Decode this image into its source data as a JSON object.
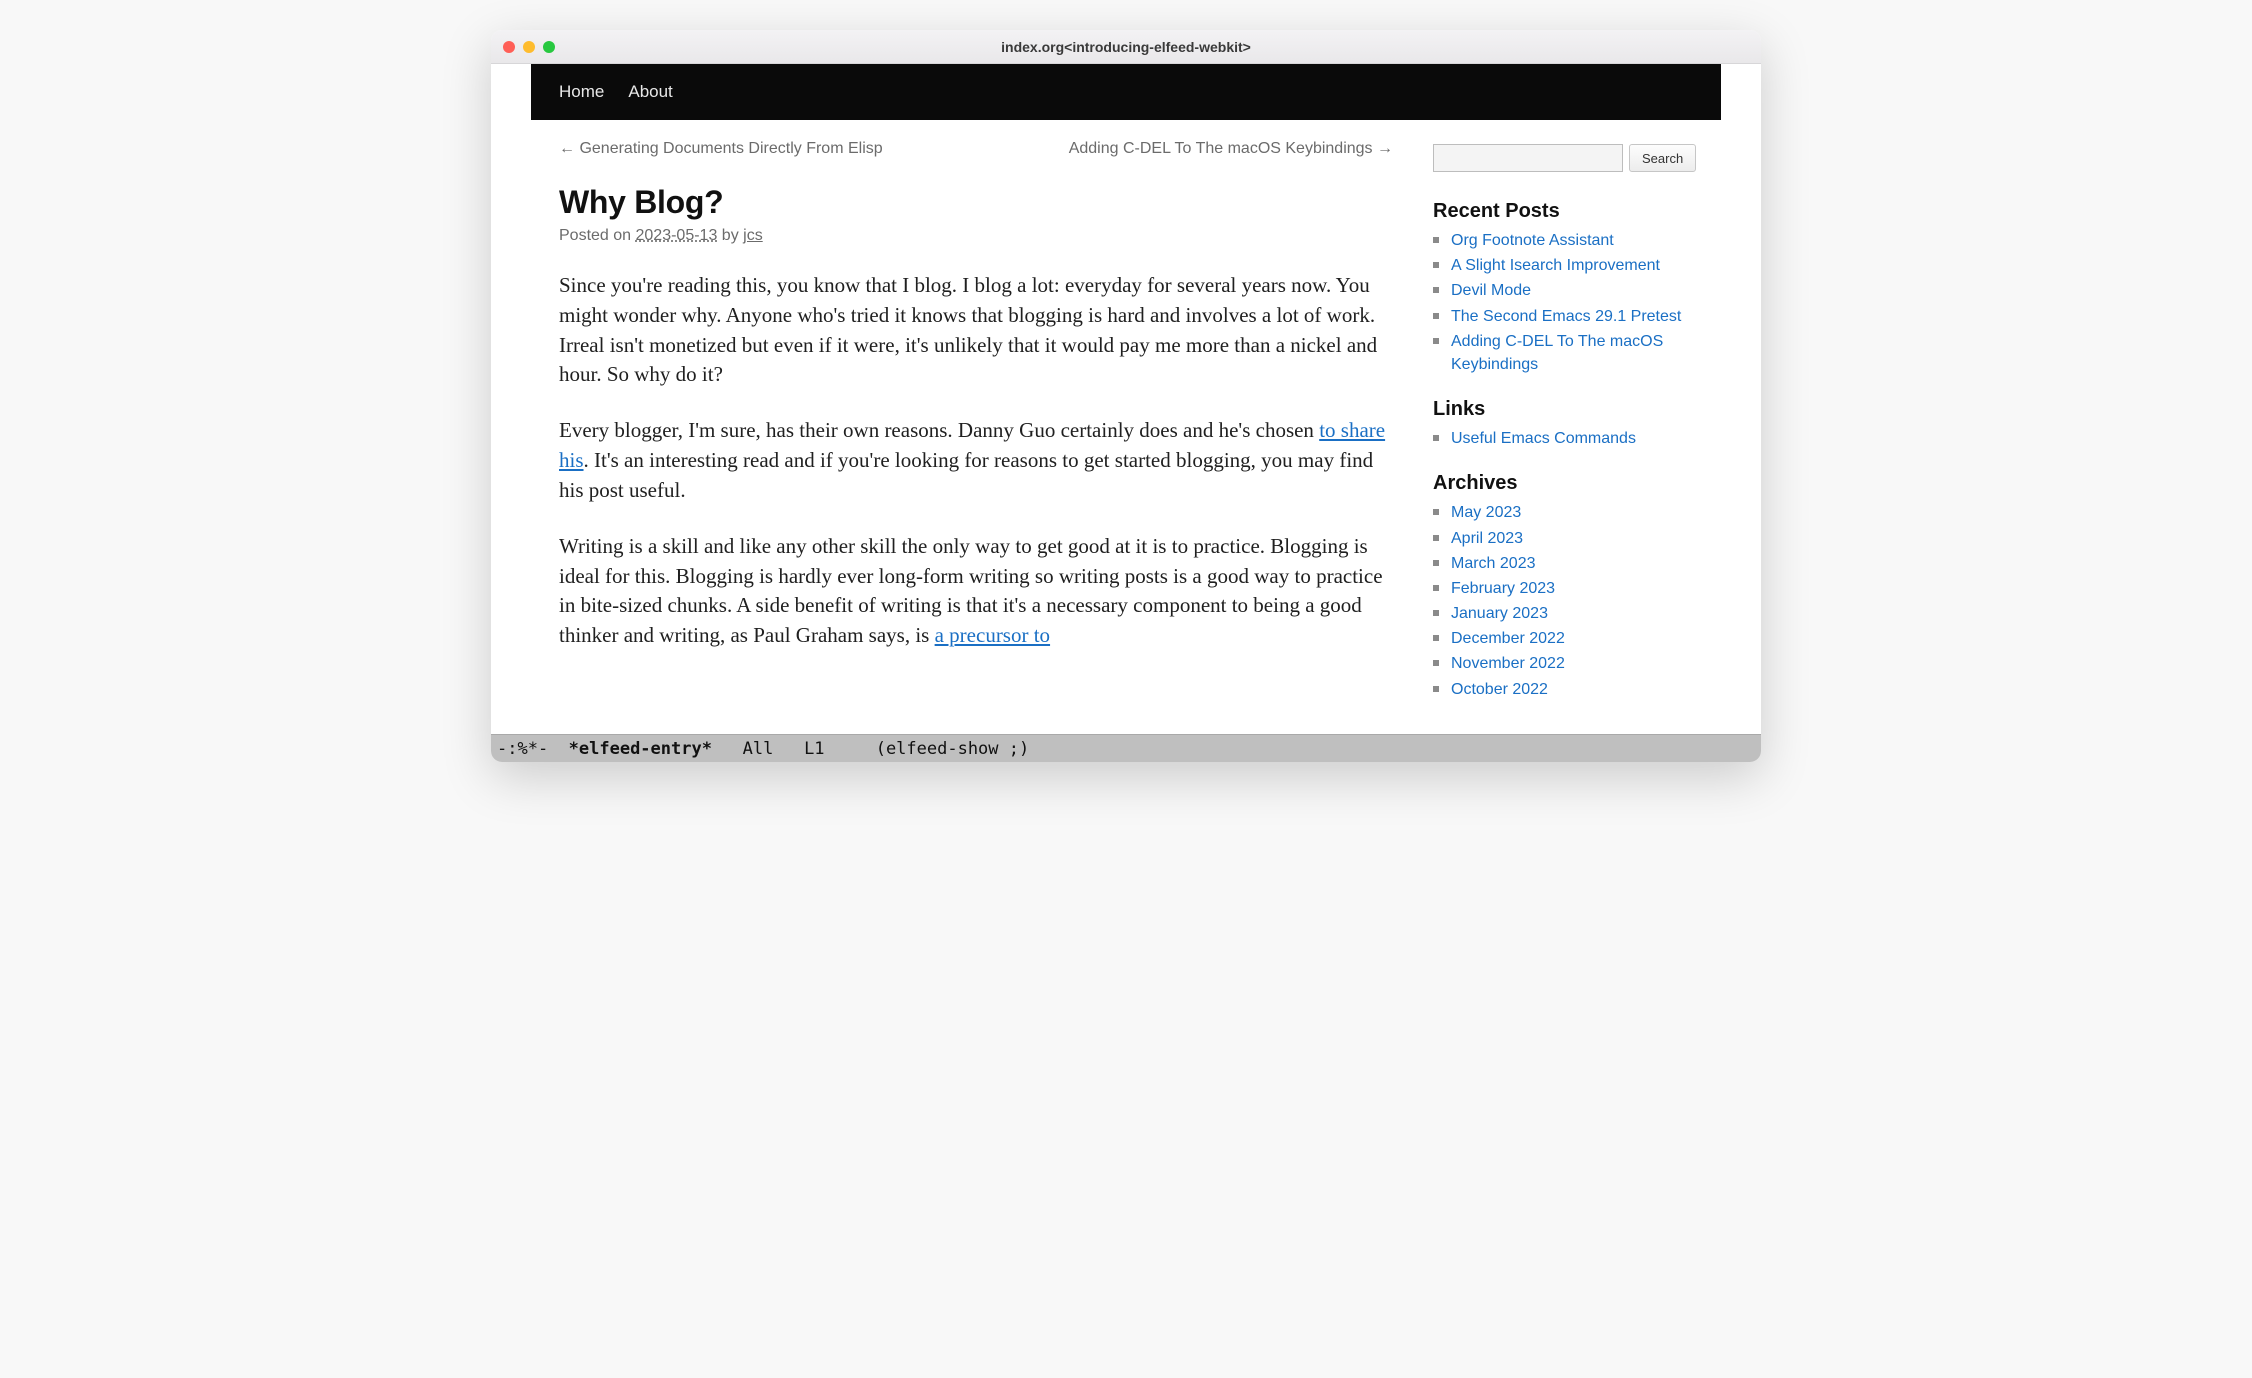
{
  "window": {
    "title": "index.org<introducing-elfeed-webkit>"
  },
  "nav": {
    "items": [
      "Home",
      "About"
    ]
  },
  "post_nav": {
    "prev": "← Generating Documents Directly From Elisp",
    "next": "Adding C-DEL To The macOS Keybindings →"
  },
  "post": {
    "title": "Why Blog?",
    "posted_on_label": "Posted on ",
    "date": "2023-05-13",
    "by_label": " by ",
    "author": "jcs",
    "p1": "Since you're reading this, you know that I blog. I blog a lot: everyday for several years now. You might wonder why. Anyone who's tried it knows that blogging is hard and involves a lot of work. Irreal isn't monetized but even if it were, it's unlikely that it would pay me more than a nickel and hour. So why do it?",
    "p2a": "Every blogger, I'm sure, has their own reasons. Danny Guo certainly does and he's chosen ",
    "p2_link": "to share his",
    "p2b": ". It's an interesting read and if you're looking for reasons to get started blogging, you may find his post useful.",
    "p3a": "Writing is a skill and like any other skill the only way to get good at it is to practice. Blogging is ideal for this. Blogging is hardly ever long-form writing so writing posts is a good way to practice in bite-sized chunks. A side benefit of writing is that it's a necessary component to being a good thinker and writing, as Paul Graham says, is ",
    "p3_link": "a precursor to"
  },
  "sidebar": {
    "search_button": "Search",
    "recent_title": "Recent Posts",
    "recent": [
      "Org Footnote Assistant",
      "A Slight Isearch Improvement",
      "Devil Mode",
      "The Second Emacs 29.1 Pretest",
      "Adding C-DEL To The macOS Keybindings"
    ],
    "links_title": "Links",
    "links": [
      "Useful Emacs Commands"
    ],
    "archives_title": "Archives",
    "archives": [
      "May 2023",
      "April 2023",
      "March 2023",
      "February 2023",
      "January 2023",
      "December 2022",
      "November 2022",
      "October 2022"
    ]
  },
  "modeline": {
    "left": "-:%*-  ",
    "buffer": "*elfeed-entry*",
    "rest": "   All   L1     (elfeed-show ;)"
  }
}
